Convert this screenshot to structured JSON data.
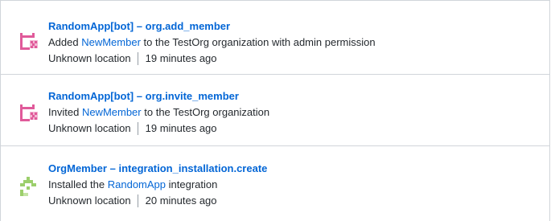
{
  "entries": [
    {
      "actor": "RandomApp[bot]",
      "separator": "–",
      "action": "org.add_member",
      "desc_prefix": "Added",
      "desc_link": "NewMember",
      "desc_suffix": "to the TestOrg organization with admin permission",
      "location": "Unknown location",
      "time": "19 minutes ago",
      "avatar_icon": "pink-bot-identicon"
    },
    {
      "actor": "RandomApp[bot]",
      "separator": "–",
      "action": "org.invite_member",
      "desc_prefix": "Invited",
      "desc_link": "NewMember",
      "desc_suffix": "to the TestOrg organization",
      "location": "Unknown location",
      "time": "19 minutes ago",
      "avatar_icon": "pink-bot-identicon"
    },
    {
      "actor": "OrgMember",
      "separator": "–",
      "action": "integration_installation.create",
      "desc_prefix": "Installed the",
      "desc_link": "RandomApp",
      "desc_suffix": "integration",
      "location": "Unknown location",
      "time": "20 minutes ago",
      "avatar_icon": "green-user-identicon"
    }
  ],
  "colors": {
    "link": "#0366d6",
    "border": "#d1d5da",
    "bot_avatar": "#e05a9a",
    "bot_avatar_light": "#f3b6d2",
    "user_avatar": "#9ccf6c"
  }
}
